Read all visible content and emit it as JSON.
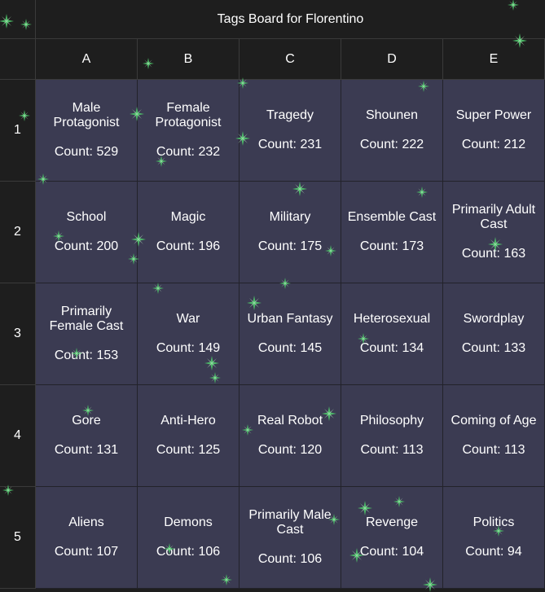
{
  "title": "Tags Board for Florentino",
  "columns": [
    "A",
    "B",
    "C",
    "D",
    "E"
  ],
  "rows": [
    "1",
    "2",
    "3",
    "4",
    "5"
  ],
  "count_label": "Count: ",
  "colors": {
    "cell_bg": "#3b3b52",
    "header_bg": "#1e1e1e",
    "sparkle": "#4fc46a"
  },
  "cells": [
    [
      {
        "tag": "Male Protagonist",
        "count": 529
      },
      {
        "tag": "Female Protagonist",
        "count": 232
      },
      {
        "tag": "Tragedy",
        "count": 231
      },
      {
        "tag": "Shounen",
        "count": 222
      },
      {
        "tag": "Super Power",
        "count": 212
      }
    ],
    [
      {
        "tag": "School",
        "count": 200
      },
      {
        "tag": "Magic",
        "count": 196
      },
      {
        "tag": "Military",
        "count": 175
      },
      {
        "tag": "Ensemble Cast",
        "count": 173
      },
      {
        "tag": "Primarily Adult Cast",
        "count": 163
      }
    ],
    [
      {
        "tag": "Primarily Female Cast",
        "count": 153
      },
      {
        "tag": "War",
        "count": 149
      },
      {
        "tag": "Urban Fantasy",
        "count": 145
      },
      {
        "tag": "Heterosexual",
        "count": 134
      },
      {
        "tag": "Swordplay",
        "count": 133
      }
    ],
    [
      {
        "tag": "Gore",
        "count": 131
      },
      {
        "tag": "Anti-Hero",
        "count": 125
      },
      {
        "tag": "Real Robot",
        "count": 120
      },
      {
        "tag": "Philosophy",
        "count": 113
      },
      {
        "tag": "Coming of Age",
        "count": 113
      }
    ],
    [
      {
        "tag": "Aliens",
        "count": 107
      },
      {
        "tag": "Demons",
        "count": 106
      },
      {
        "tag": "Primarily Male Cast",
        "count": 106
      },
      {
        "tag": "Revenge",
        "count": 104
      },
      {
        "tag": "Politics",
        "count": 94
      }
    ]
  ]
}
